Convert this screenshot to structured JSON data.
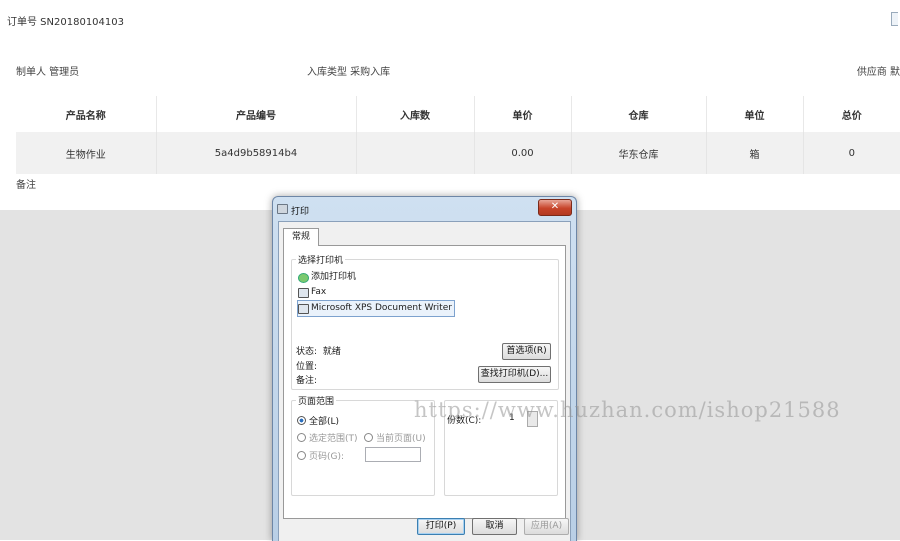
{
  "order": {
    "label_value": "订单号 SN20180104103"
  },
  "meta": {
    "creator": "制单人 管理员",
    "stock_in_type": "入库类型 采购入库",
    "supplier": "供应商 默"
  },
  "table": {
    "headers": [
      "产品名称",
      "产品编号",
      "入库数",
      "单价",
      "仓库",
      "单位",
      "总价"
    ],
    "rows": [
      [
        "生物作业",
        "5a4d9b58914b4",
        "",
        "0.00",
        "华东仓库",
        "箱",
        "0"
      ]
    ]
  },
  "remark_label": "备注",
  "dialog": {
    "title": "打印",
    "close_glyph": "✕",
    "tab_general": "常规",
    "select_printer_legend": "选择打印机",
    "printers": [
      {
        "name": "添加打印机",
        "icon": "add-printer-icon"
      },
      {
        "name": "Fax",
        "icon": "fax-icon"
      },
      {
        "name": "Microsoft XPS Document Writer",
        "icon": "printer-icon"
      }
    ],
    "selected_printer": "Microsoft XPS Document Writer",
    "status_label": "状态:",
    "status_value": "就绪",
    "location_label": "位置:",
    "comment_label": "备注:",
    "preferences_button": "首选项(R)",
    "find_printer_button": "查找打印机(D)...",
    "page_range_legend": "页面范围",
    "range_all": "全部(L)",
    "range_selection": "选定范围(T)",
    "range_current": "当前页面(U)",
    "range_pages": "页码(G):",
    "copies_label": "份数(C):",
    "copies_value": "1",
    "print_button": "打印(P)",
    "cancel_button": "取消",
    "apply_button": "应用(A)"
  },
  "watermark": "https://www.huzhan.com/ishop21588"
}
